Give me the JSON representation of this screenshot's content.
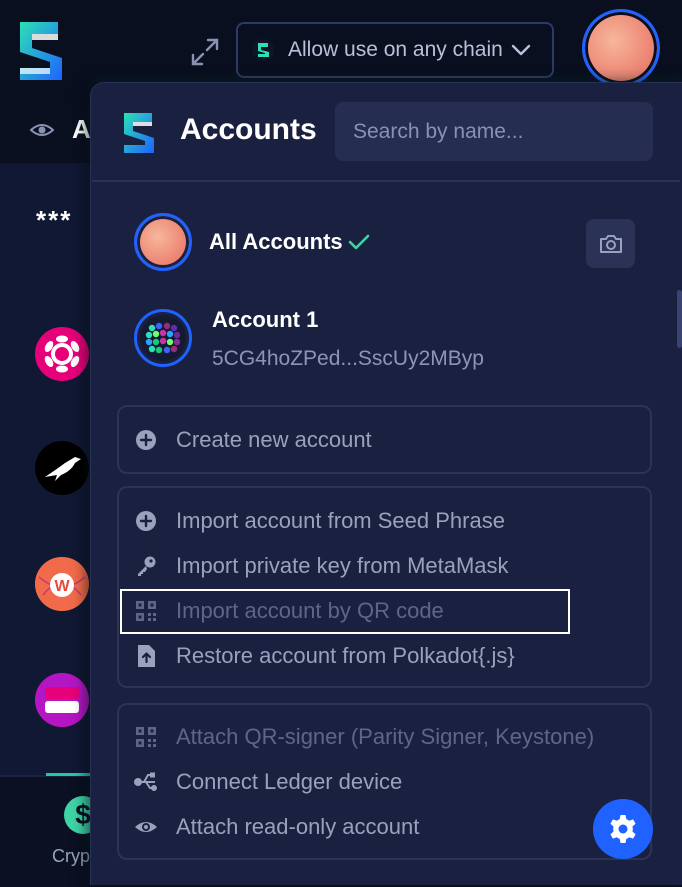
{
  "header": {
    "chain_selector": {
      "label": "Allow use on any chain",
      "icon": "chain-logo-icon"
    },
    "icons": [
      "app-logo-icon",
      "expand-icon",
      "chevron-down-icon",
      "avatar"
    ]
  },
  "background": {
    "heading_partial": "A",
    "balance_masked": "***",
    "bottom_nav_label_partial": "Cryp"
  },
  "accounts_panel": {
    "title": "Accounts",
    "search": {
      "placeholder": "Search by name..."
    },
    "all_accounts": {
      "label": "All Accounts"
    },
    "accounts": [
      {
        "name": "Account 1",
        "address": "5CG4hoZPed...SscUy2MByp"
      }
    ],
    "actions": {
      "create": [
        {
          "label": "Create new account",
          "icon": "plus-circle-icon",
          "state": "normal"
        }
      ],
      "import": [
        {
          "label": "Import account from Seed Phrase",
          "icon": "plus-circle-icon",
          "state": "normal"
        },
        {
          "label": "Import private key from MetaMask",
          "icon": "key-icon",
          "state": "normal"
        },
        {
          "label": "Import account by QR code",
          "icon": "qr-code-icon",
          "state": "disabled"
        },
        {
          "label": "Restore account from Polkadot{.js}",
          "icon": "file-upload-icon",
          "state": "normal"
        }
      ],
      "attach": [
        {
          "label": "Attach QR-signer (Parity Signer, Keystone)",
          "icon": "qr-code-icon",
          "state": "disabled"
        },
        {
          "label": "Connect Ledger device",
          "icon": "usb-icon",
          "state": "normal"
        },
        {
          "label": "Attach read-only account",
          "icon": "eye-icon",
          "state": "normal"
        }
      ]
    }
  },
  "colors": {
    "background": "#0c1124",
    "panel": "#1a2140",
    "accent_blue": "#1f62ff",
    "accent_green": "#3fd4a6",
    "text_muted": "#9aa1bd",
    "text_disabled": "#5e6688"
  }
}
